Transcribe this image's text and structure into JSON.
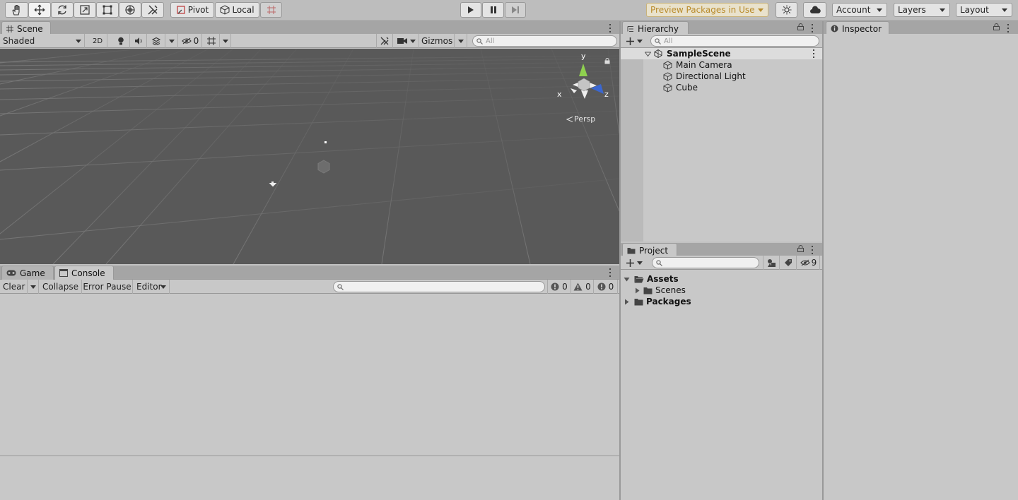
{
  "toolbar": {
    "tools": [
      "hand-tool",
      "move-tool",
      "rotate-tool",
      "scale-tool",
      "rect-tool",
      "transform-tool",
      "custom-tool"
    ],
    "pivot_label": "Pivot",
    "local_label": "Local",
    "preview_packages": "Preview Packages in Use",
    "account": "Account",
    "layers": "Layers",
    "layout": "Layout"
  },
  "scene": {
    "tab": "Scene",
    "draw_mode": "Shaded",
    "mode_2d": "2D",
    "hidden_count": "0",
    "gizmos": "Gizmos",
    "search_placeholder": "All",
    "persp_label": "Persp",
    "axis_y": "y",
    "axis_x": "x",
    "axis_z": "z"
  },
  "console": {
    "tabs": [
      "Game",
      "Console"
    ],
    "clear": "Clear",
    "collapse": "Collapse",
    "error_pause": "Error Pause",
    "editor": "Editor",
    "info_count": "0",
    "warn_count": "0",
    "error_count": "0"
  },
  "hierarchy": {
    "tab": "Hierarchy",
    "search_placeholder": "All",
    "scene_name": "SampleScene",
    "objects": [
      "Main Camera",
      "Directional Light",
      "Cube"
    ]
  },
  "project": {
    "tab": "Project",
    "hidden_packages": "9",
    "assets": "Assets",
    "scenes": "Scenes",
    "packages": "Packages"
  },
  "inspector": {
    "tab": "Inspector"
  }
}
